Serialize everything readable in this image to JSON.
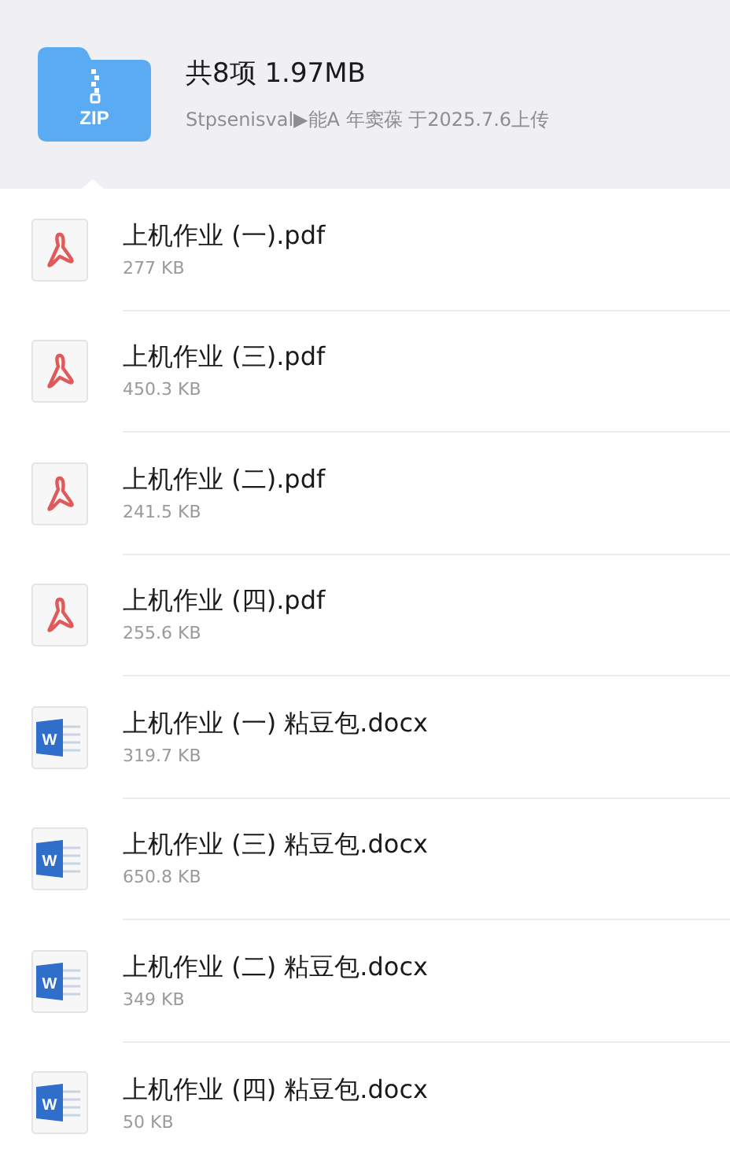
{
  "archive": {
    "icon_label": "ZIP",
    "title": "共8项 1.97MB",
    "subtitle": "Stpsenisval▶能A 年窦葆 于2025.7.6上传"
  },
  "files": [
    {
      "kind": "pdf",
      "name": "上机作业 (一).pdf",
      "size": "277 KB"
    },
    {
      "kind": "pdf",
      "name": "上机作业 (三).pdf",
      "size": "450.3 KB"
    },
    {
      "kind": "pdf",
      "name": "上机作业 (二).pdf",
      "size": "241.5 KB"
    },
    {
      "kind": "pdf",
      "name": "上机作业 (四).pdf",
      "size": "255.6 KB"
    },
    {
      "kind": "word",
      "icon_label": "W",
      "name": "上机作业 (一) 粘豆包.docx",
      "size": "319.7 KB"
    },
    {
      "kind": "word",
      "icon_label": "W",
      "name": "上机作业 (三) 粘豆包.docx",
      "size": "650.8 KB"
    },
    {
      "kind": "word",
      "icon_label": "W",
      "name": "上机作业 (二) 粘豆包.docx",
      "size": "349 KB"
    },
    {
      "kind": "word",
      "icon_label": "W",
      "name": "上机作业 (四) 粘豆包.docx",
      "size": "50 KB"
    }
  ]
}
